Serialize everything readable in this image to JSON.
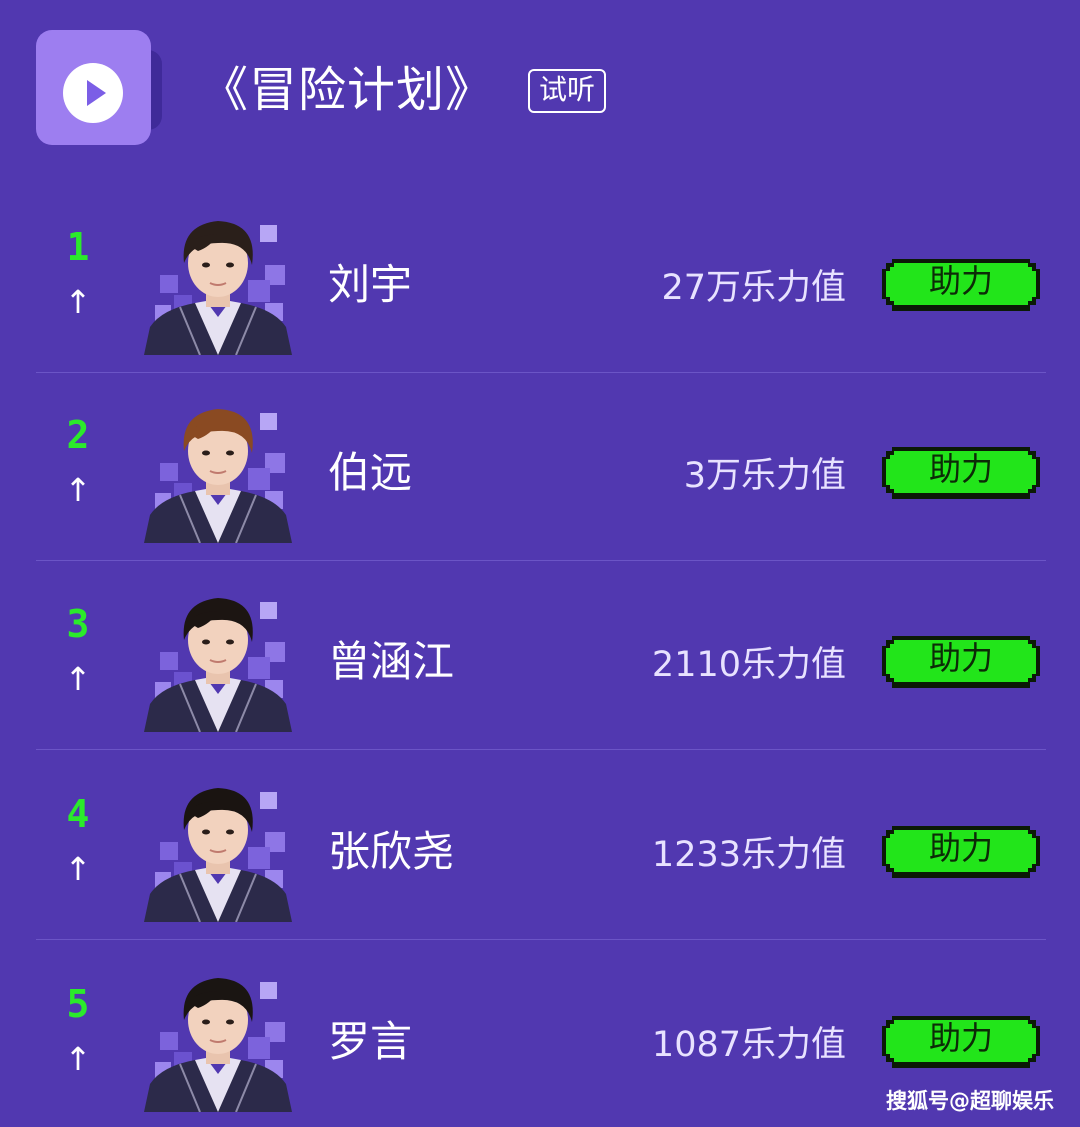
{
  "header": {
    "icon": "play-icon",
    "song_title": "《冒险计划》",
    "listen_label": "试听"
  },
  "ranking": [
    {
      "rank": "1",
      "trend": "↑",
      "name": "刘宇",
      "score": "27万乐力值",
      "boost_label": "助力",
      "hair": "#2a1f1a"
    },
    {
      "rank": "2",
      "trend": "↑",
      "name": "伯远",
      "score": "3万乐力值",
      "boost_label": "助力",
      "hair": "#8a4a22"
    },
    {
      "rank": "3",
      "trend": "↑",
      "name": "曾涵江",
      "score": "2110乐力值",
      "boost_label": "助力",
      "hair": "#1c1512"
    },
    {
      "rank": "4",
      "trend": "↑",
      "name": "张欣尧",
      "score": "1233乐力值",
      "boost_label": "助力",
      "hair": "#1a1411"
    },
    {
      "rank": "5",
      "trend": "↑",
      "name": "罗言",
      "score": "1087乐力值",
      "boost_label": "助力",
      "hair": "#1a1512"
    }
  ],
  "watermark": "搜狐号@超聊娱乐",
  "colors": {
    "background": "#5138b0",
    "rank": "#2bea2b",
    "button": "#22e51a",
    "button_border": "#0b1a06",
    "divider": "#6b55c6"
  }
}
